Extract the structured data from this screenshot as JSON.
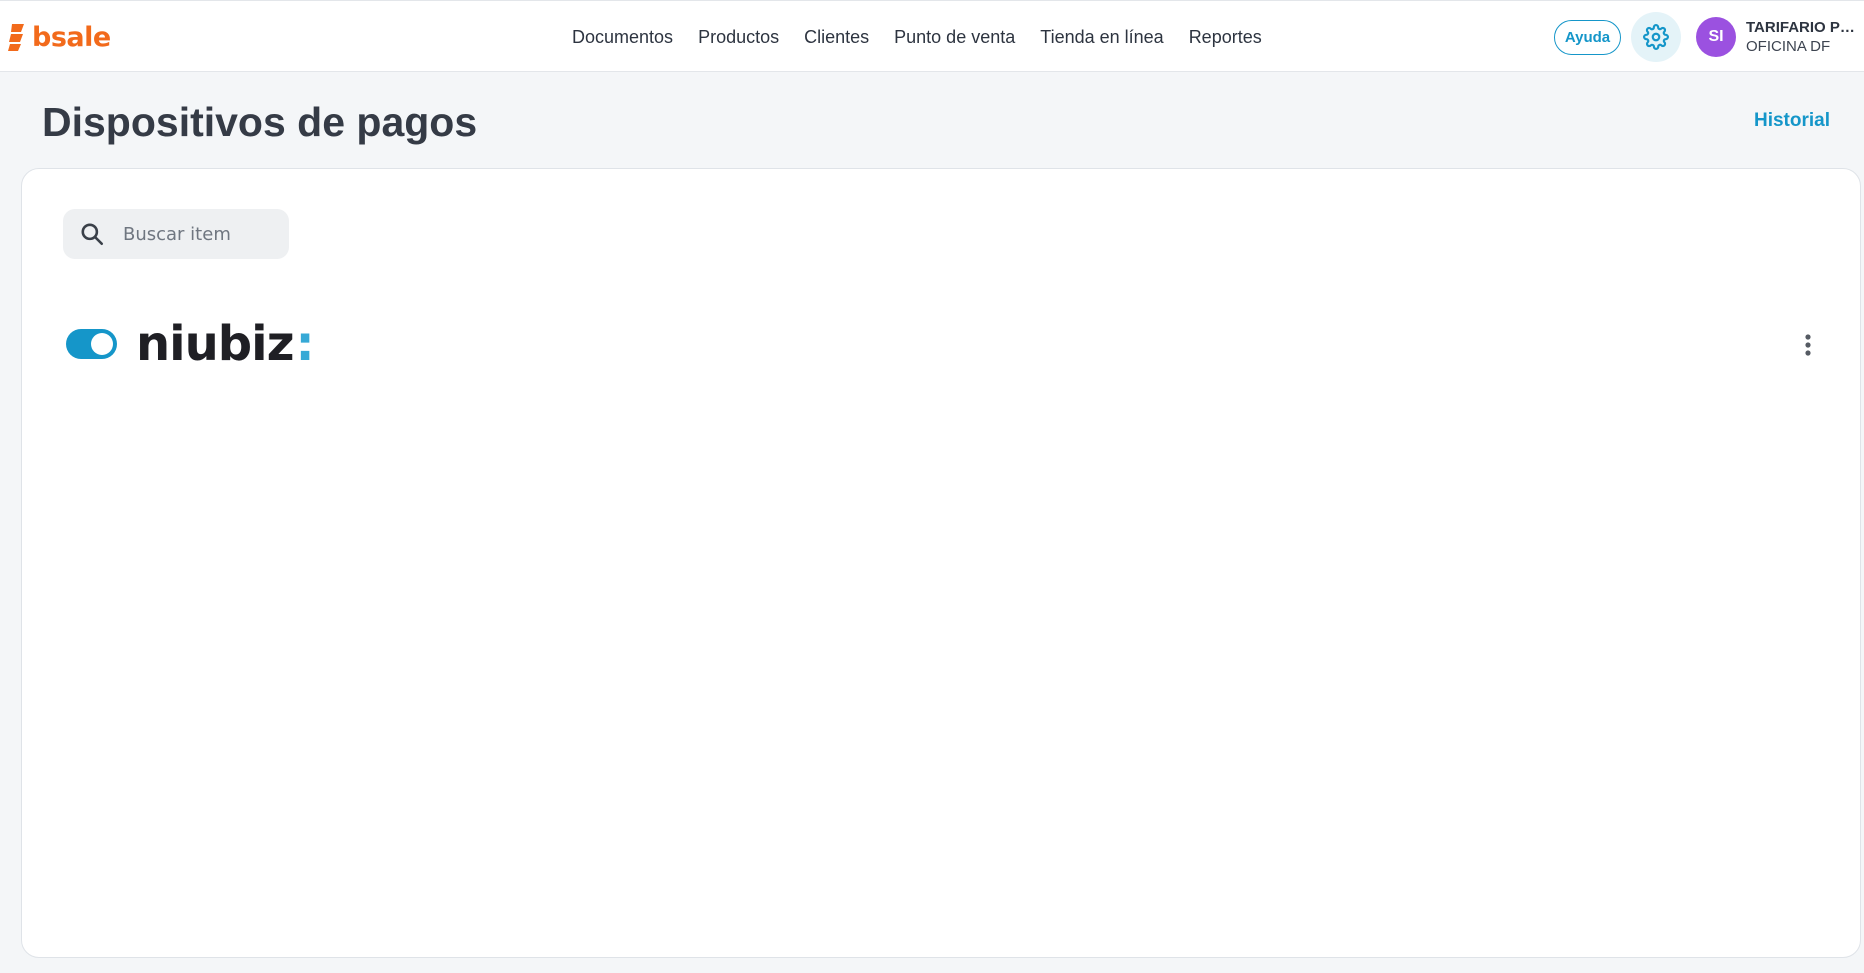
{
  "brand": {
    "name": "bsale",
    "color": "#f26a1b",
    "icon": "bsale-logo-icon"
  },
  "nav": {
    "items": [
      {
        "label": "Documentos"
      },
      {
        "label": "Productos"
      },
      {
        "label": "Clientes"
      },
      {
        "label": "Punto de venta"
      },
      {
        "label": "Tienda en línea"
      },
      {
        "label": "Reportes"
      }
    ]
  },
  "header": {
    "help_label": "Ayuda",
    "settings_icon": "gear-icon",
    "avatar_initials": "SI",
    "avatar_color": "#9b51e0",
    "account_name": "TARIFARIO PERU",
    "account_branch": "OFICINA DF"
  },
  "page": {
    "title": "Dispositivos de pagos",
    "history_label": "Historial"
  },
  "search": {
    "placeholder": "Buscar item",
    "value": "",
    "icon": "search-icon"
  },
  "devices": [
    {
      "provider": "niubiz",
      "provider_suffix": ":",
      "enabled": true,
      "toggle_color": "#1596c9",
      "menu_icon": "vertical-dots-icon"
    }
  ],
  "colors": {
    "accent": "#1596c9",
    "page_background": "#f4f6f8",
    "card_background": "#ffffff"
  }
}
